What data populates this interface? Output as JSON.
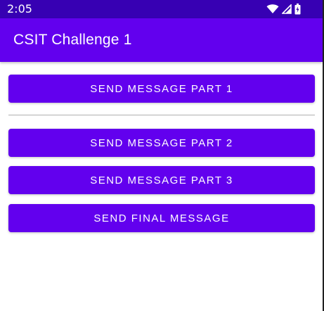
{
  "status_bar": {
    "time": "2:05",
    "icons": [
      "wifi-icon",
      "signal-icon",
      "battery-icon"
    ]
  },
  "app_bar": {
    "title": "CSIT Challenge 1"
  },
  "buttons": [
    {
      "label": "Send message part 1"
    },
    {
      "label": "Send message part 2"
    },
    {
      "label": "Send message part 3"
    },
    {
      "label": "Send final message"
    }
  ],
  "colors": {
    "status_bar": "#3700b3",
    "primary": "#6200ee",
    "on_primary": "#ffffff",
    "divider": "#b0b0b0"
  }
}
